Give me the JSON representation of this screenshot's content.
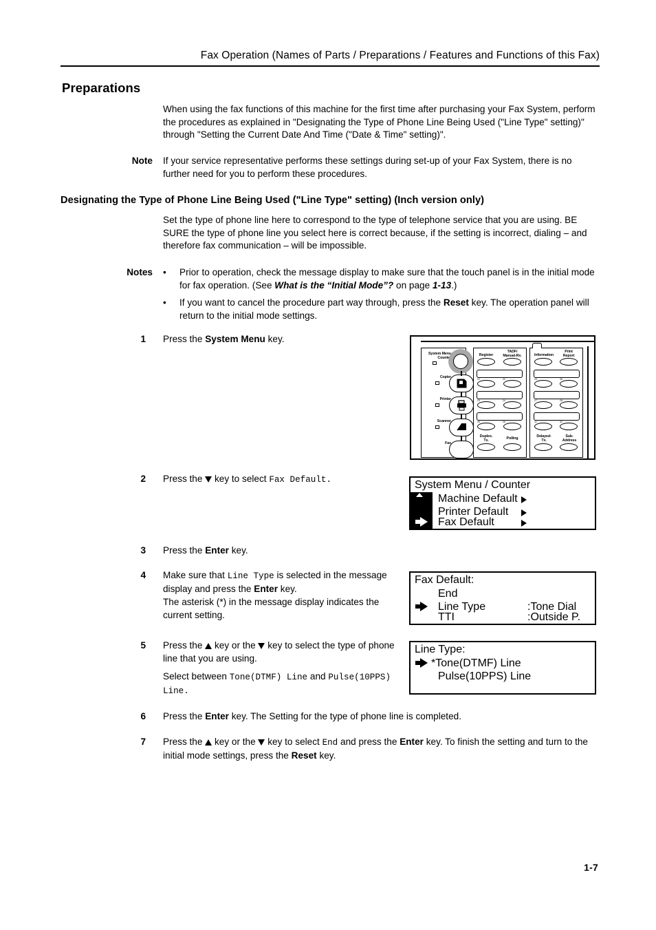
{
  "header": {
    "running_title": "Fax Operation (Names of Parts / Preparations / Features and Functions of this Fax)"
  },
  "headings": {
    "section_title": "Preparations",
    "subsection_title": "Designating the Type of Phone Line Being Used  (\"Line Type\" setting) (Inch version only)"
  },
  "intro": {
    "paragraph": "When using the fax functions of this machine for the first time after purchasing your Fax System, perform the procedures as explained in \"Designating the Type of Phone Line Being Used (\"Line Type\" setting)\" through \"Setting the Current Date And Time (\"Date & Time\" setting)\"."
  },
  "note": {
    "label": "Note",
    "text": "If your service representative performs these settings during set-up of your Fax System, there is no further need for you to perform these procedures."
  },
  "subsection_body": {
    "paragraph": "Set the type of phone line here to correspond to the type of telephone service that you are using. BE SURE the type of phone line you select here is correct because, if the setting is incorrect, dialing – and therefore fax communication – will be impossible."
  },
  "notes": {
    "label": "Notes",
    "bullet_marker": "•",
    "items": [
      {
        "part1": "Prior to operation, check the message display to make sure that the touch panel is in the initial mode for fax operation. (See ",
        "emphasis": "What is the “Initial Mode”?",
        "part2": " on page ",
        "page_ref": "1-13",
        "part3": ".)"
      },
      {
        "part1": "If you want to cancel the procedure part way through, press the ",
        "bold1": "Reset",
        "part2": " key. The operation panel will return to the initial mode settings."
      }
    ]
  },
  "steps": [
    {
      "num": "1",
      "line1_a": "Press the ",
      "line1_bold": "System Menu",
      "line1_b": " key."
    },
    {
      "num": "2",
      "line1_a": "Press the ",
      "line1_arrow": "down",
      "line1_b": " key to select ",
      "line1_mono": "Fax Default."
    },
    {
      "num": "3",
      "line1_a": "Press the ",
      "line1_bold": "Enter",
      "line1_b": " key."
    },
    {
      "num": "4",
      "line1_a": "Make sure that ",
      "line1_mono": "Line Type",
      "line1_b": " is selected in the message display and press the ",
      "line1_bold": "Enter",
      "line1_c": " key.",
      "para2": "The asterisk (*) in the message display indicates the current setting."
    },
    {
      "num": "5",
      "line1_a": "Press the ",
      "line1_b": " key or the ",
      "line1_c": " key to select the type of phone line that you are using.",
      "para2_a": "Select between ",
      "para2_mono1": "Tone(DTMF) Line",
      "para2_b": " and ",
      "para2_mono2": "Pulse(10PPS) Line."
    },
    {
      "num": "6",
      "line1_a": "Press the ",
      "line1_bold": "Enter",
      "line1_b": " key. The Setting for the type of phone line is completed."
    },
    {
      "num": "7",
      "line1_a": "Press the ",
      "line1_b": " key or the ",
      "line1_c": " key to select ",
      "line1_mono": "End",
      "line1_d": " and press the ",
      "line1_bold1": "Enter",
      "line1_e": " key. To finish the setting and turn to the initial mode settings, press the ",
      "line1_bold2": "Reset",
      "line1_f": " key."
    }
  ],
  "control_panel": {
    "mode_keys": [
      {
        "label": "System Menu/\nCounter",
        "name": "system-menu-counter"
      },
      {
        "label": "Copier",
        "name": "copier"
      },
      {
        "label": "Printer",
        "name": "printer"
      },
      {
        "label": "Scanner",
        "name": "scanner"
      },
      {
        "label": "Fax",
        "name": "fax"
      }
    ],
    "mode_key_labels": {
      "system_menu_line1": "System Menu",
      "system_menu_line2": "Counter",
      "copier": "Copier",
      "printer": "Printer",
      "scanner": "Scanner",
      "fax": "Fax"
    },
    "function_keys_left": [
      "Register",
      "TADF/\nManual-Rx."
    ],
    "function_keys_left_labels": {
      "register": "Register",
      "tadf_line1": "TADF/",
      "tadf_line2": "Manual-Rx."
    },
    "function_keys_right_labels": {
      "information": "Information",
      "print_line1": "Print",
      "print_line2": "Report"
    },
    "bottom_keys_left": {
      "duplex_line1": "Duplex.",
      "duplex_line2": "Tx.",
      "polling": "Polling"
    },
    "bottom_keys_right": {
      "delayed_line1": "Delayed-",
      "delayed_line2": "Tx.",
      "sub_line1": "Sub-",
      "sub_line2": "Address"
    },
    "one_touch_numbers_left": [
      "21",
      "22",
      "23",
      "24",
      "25",
      "26"
    ],
    "one_touch_numbers_right": [
      "29",
      "30",
      "27",
      "28",
      "31",
      "32"
    ],
    "highlight_color": "#a8a8a8"
  },
  "lcd_system_menu": {
    "title": "System Menu / Counter",
    "rows": [
      {
        "label": "Machine Default",
        "has_submenu": true,
        "selected": false
      },
      {
        "label": "Printer Default",
        "has_submenu": true,
        "selected": false
      },
      {
        "label": "Fax Default",
        "has_submenu": true,
        "selected": true
      }
    ]
  },
  "lcd_fax_default": {
    "title": "Fax Default:",
    "rows": [
      {
        "label": "End",
        "value": "",
        "selected": false
      },
      {
        "label": "Line Type",
        "value": ":Tone Dial",
        "selected": true
      },
      {
        "label": "TTI",
        "value": ":Outside P.",
        "selected": false
      }
    ]
  },
  "lcd_line_type": {
    "title": "Line Type:",
    "rows": [
      {
        "label": "*Tone(DTMF) Line",
        "selected": true
      },
      {
        "label": "Pulse(10PPS) Line",
        "selected": false
      }
    ]
  },
  "footer": {
    "page_number": "1-7"
  }
}
